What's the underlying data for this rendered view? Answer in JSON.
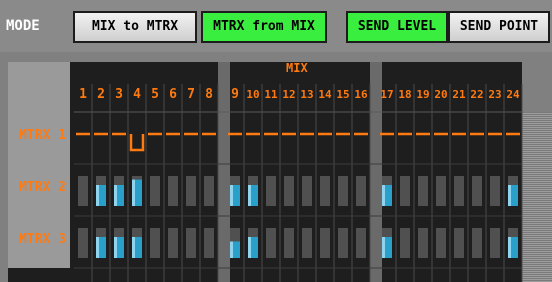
{
  "mode": "MODE",
  "buttons": {
    "mix_to_mtrx": "MIX to MTRX",
    "mtrx_from_mix": "MTRX from MIX",
    "send_level": "SEND LEVEL",
    "send_point": "SEND POINT"
  },
  "grid": {
    "header": "MIX",
    "columns": [
      "1",
      "2",
      "3",
      "4",
      "5",
      "6",
      "7",
      "8",
      "9",
      "10",
      "11",
      "12",
      "13",
      "14",
      "15",
      "16",
      "17",
      "18",
      "19",
      "20",
      "21",
      "22",
      "23",
      "24"
    ],
    "rows": [
      {
        "label": "MTRX 1",
        "levels": [
          null,
          null,
          null,
          "point",
          null,
          null,
          null,
          null,
          null,
          null,
          null,
          null,
          null,
          null,
          null,
          null,
          null,
          null,
          null,
          null,
          null,
          null,
          null,
          null
        ]
      },
      {
        "label": "MTRX 2",
        "levels": [
          0,
          0.7,
          0.7,
          0.88,
          0,
          0,
          0,
          0,
          0.7,
          0.7,
          0,
          0,
          0,
          0,
          0,
          0,
          0.7,
          0,
          0,
          0,
          0,
          0,
          0,
          0.7
        ]
      },
      {
        "label": "MTRX 3",
        "levels": [
          0,
          0.7,
          0.7,
          0.7,
          0,
          0,
          0,
          0,
          0.55,
          0.7,
          0,
          0,
          0,
          0,
          0,
          0,
          0.7,
          0,
          0,
          0,
          0,
          0,
          0,
          0.7
        ]
      }
    ]
  },
  "colors": {
    "accent": "#ff7a10",
    "button_on": "#39ee3e",
    "meter_fill": "#2a9fc9",
    "meter_bg": "#505050"
  }
}
